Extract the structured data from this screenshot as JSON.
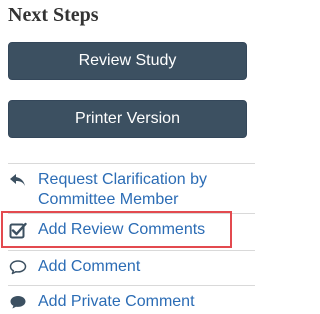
{
  "panel": {
    "title": "Next Steps"
  },
  "buttons": {
    "review_study": "Review Study",
    "printer_version": "Printer Version"
  },
  "actions": [
    {
      "icon": "reply-arrow-icon",
      "label": "Request Clarification by Committee Member"
    },
    {
      "icon": "checkbox-checked-icon",
      "label": "Add Review Comments"
    },
    {
      "icon": "speech-bubble-outline-icon",
      "label": "Add Comment"
    },
    {
      "icon": "speech-bubble-filled-icon",
      "label": "Add Private Comment"
    }
  ],
  "colors": {
    "button_bg": "#3c5061",
    "link": "#2b6cb5",
    "highlight": "#e34a4f",
    "title": "#333333",
    "divider": "#d9d9d9"
  }
}
